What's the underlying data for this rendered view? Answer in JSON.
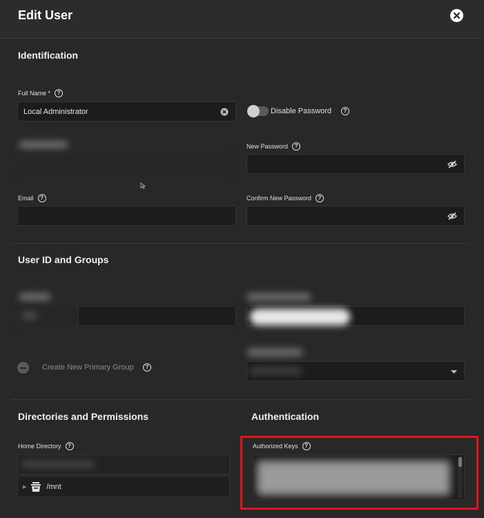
{
  "dialog": {
    "title": "Edit User",
    "close_icon": "close-icon"
  },
  "identification": {
    "title": "Identification",
    "full_name": {
      "label": "Full Name *",
      "value": "Local Administrator"
    },
    "disable_password": {
      "label": "Disable Password",
      "checked": false
    },
    "username": {
      "label": "",
      "value": ""
    },
    "new_password": {
      "label": "New Password",
      "value": ""
    },
    "email": {
      "label": "Email",
      "value": ""
    },
    "confirm_password": {
      "label": "Confirm New Password",
      "value": ""
    }
  },
  "user_id_groups": {
    "title": "User ID and Groups",
    "create_primary_group": {
      "label": "Create New Primary Group",
      "checked": false
    }
  },
  "directories": {
    "title": "Directories and Permissions",
    "home_directory": {
      "label": "Home Directory",
      "tree_root": "/mnt"
    }
  },
  "authentication": {
    "title": "Authentication",
    "authorized_keys": {
      "label": "Authorized Keys"
    }
  }
}
